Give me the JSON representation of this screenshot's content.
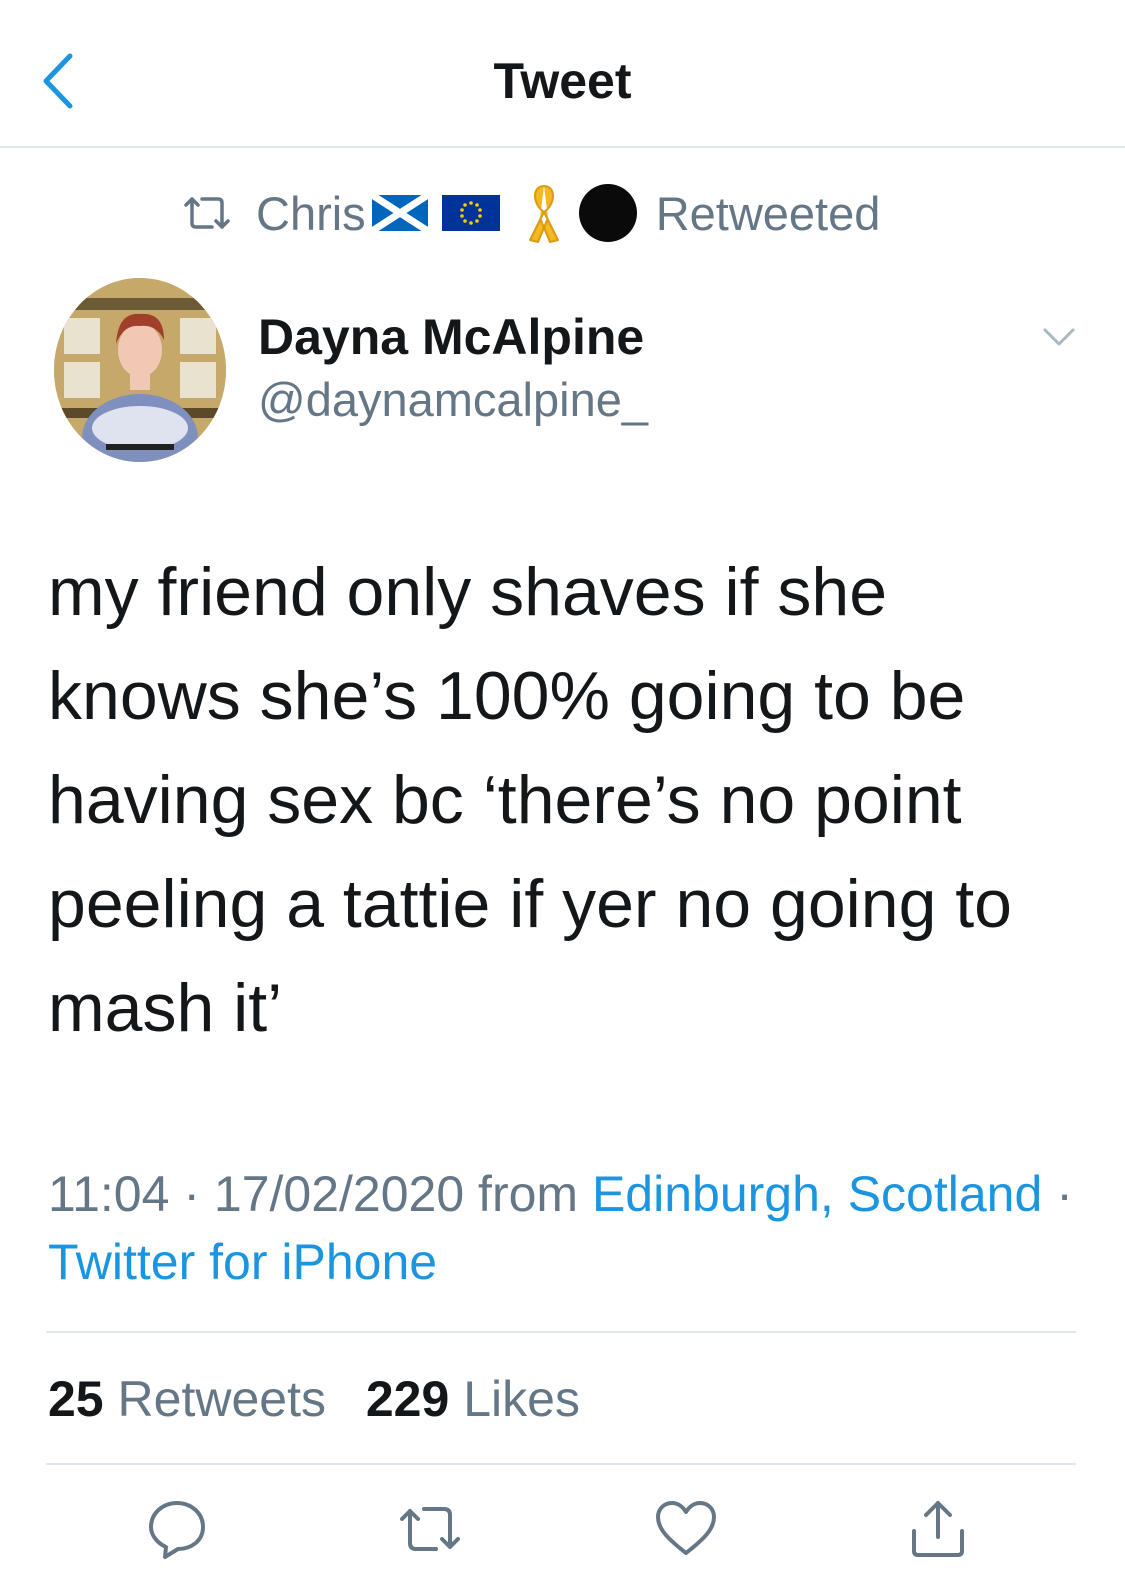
{
  "header": {
    "title": "Tweet",
    "back_icon": "chevron-left-icon"
  },
  "retweet_banner": {
    "icon": "retweet-icon",
    "user_name": "Chris",
    "emoji": [
      "scotland-flag",
      "eu-flag",
      "yellow-ribbon",
      "black-circle"
    ],
    "suffix": "Retweeted"
  },
  "tweet": {
    "author_name": "Dayna McAlpine",
    "author_handle": "@daynamcalpine_",
    "text": "my friend only shaves if she knows she’s 100% going to be having sex bc ‘there’s no point peeling a tattie if yer no going to mash it’",
    "time": "11:04",
    "date": "17/02/2020",
    "from_word": "from",
    "location": "Edinburgh, Scotland",
    "separator": "·",
    "source": "Twitter for iPhone"
  },
  "stats": {
    "retweets_count": "25",
    "retweets_label": "Retweets",
    "likes_count": "229",
    "likes_label": "Likes"
  },
  "actions": [
    "reply-icon",
    "retweet-icon",
    "like-icon",
    "share-icon"
  ],
  "colors": {
    "accent": "#1b95e0",
    "secondary_text": "#657786",
    "primary_text": "#14171a",
    "divider": "#e1e8ed"
  }
}
